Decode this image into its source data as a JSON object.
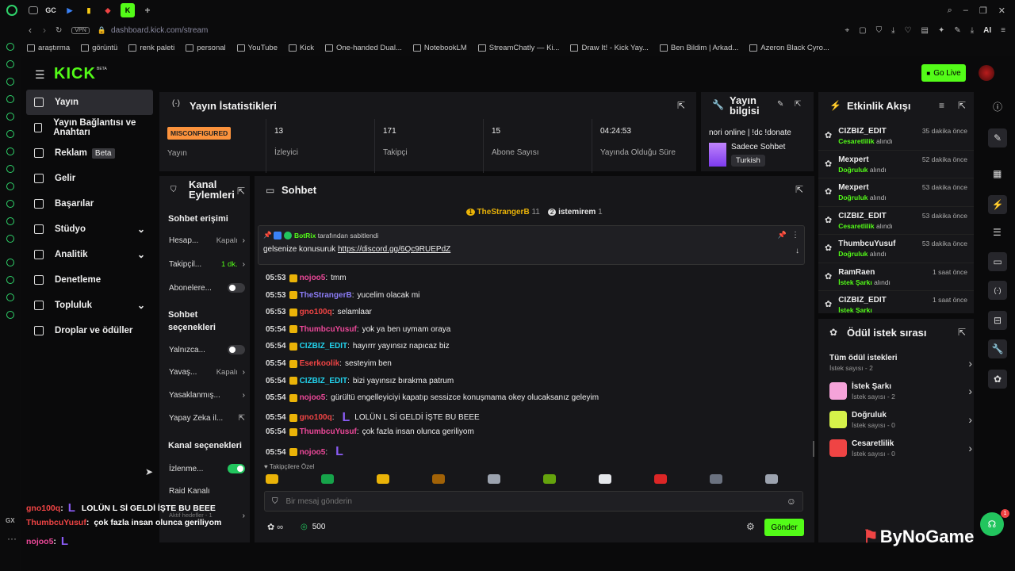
{
  "browser": {
    "url": "dashboard.kick.com/stream",
    "vpn": "VPN",
    "tab_text": "GC",
    "bookmarks": [
      "araştırma",
      "görüntü",
      "renk paleti",
      "personal",
      "YouTube",
      "Kick",
      "One-handed Dual...",
      "NotebookLM",
      "StreamChatly — Ki...",
      "Draw It! - Kick Yay...",
      "Ben Bildim | Arkad...",
      "Azeron Black Cyro..."
    ],
    "ai_label": "AI",
    "rail_bottom": "GX"
  },
  "header": {
    "logo": "KICK",
    "logo_beta": "BETA",
    "go_live": "Go Live"
  },
  "sidebar": {
    "items": [
      {
        "label": "Yayın",
        "active": true
      },
      {
        "label": "Yayın Bağlantısı ve Anahtarı"
      },
      {
        "label": "Reklam",
        "badge": "Beta"
      },
      {
        "label": "Gelir"
      },
      {
        "label": "Başarılar"
      },
      {
        "label": "Stüdyo",
        "chev": "⌄"
      },
      {
        "label": "Analitik",
        "chev": "⌄"
      },
      {
        "label": "Denetleme"
      },
      {
        "label": "Topluluk",
        "chev": "⌄"
      },
      {
        "label": "Droplar ve ödüller"
      }
    ]
  },
  "stats": {
    "title": "Yayın İstatistikleri",
    "status_badge": "MISCONFIGURED",
    "status_label": "Yayın",
    "items": [
      {
        "value": "13",
        "label": "İzleyici"
      },
      {
        "value": "171",
        "label": "Takipçi"
      },
      {
        "value": "15",
        "label": "Abone Sayısı"
      },
      {
        "value": "04:24:53",
        "label": "Yayında Olduğu Süre"
      }
    ]
  },
  "info": {
    "title": "Yayın bilgisi",
    "stream_title": "nori online | !dc !donate",
    "category": "Sadece Sohbet",
    "language": "Turkish"
  },
  "events": {
    "title": "Etkinlik Akışı",
    "items": [
      {
        "name": "CIZBIZ_EDIT",
        "reward": "Cesaretlilik",
        "suffix": "alındı",
        "time": "35 dakika önce"
      },
      {
        "name": "Mexpert",
        "reward": "Doğruluk",
        "suffix": "alındı",
        "time": "52 dakika önce"
      },
      {
        "name": "Mexpert",
        "reward": "Doğruluk",
        "suffix": "alındı",
        "time": "53 dakika önce"
      },
      {
        "name": "CIZBIZ_EDIT",
        "reward": "Cesaretlilik",
        "suffix": "alındı",
        "time": "53 dakika önce"
      },
      {
        "name": "ThumbcuYusuf",
        "reward": "Doğruluk",
        "suffix": "alındı",
        "time": "53 dakika önce"
      },
      {
        "name": "RamRaen",
        "reward": "İstek Şarkı",
        "suffix": "alındı",
        "time": "1 saat önce"
      },
      {
        "name": "CIZBIZ_EDIT",
        "reward": "İstek Şarkı",
        "suffix": "",
        "time": "1 saat önce"
      }
    ]
  },
  "rewards": {
    "title": "Ödül istek sırası",
    "all_label": "Tüm ödül istekleri",
    "all_count": "İstek sayısı - 2",
    "items": [
      {
        "name": "İstek Şarkı",
        "count": "İstek sayısı - 2",
        "color": "#f5a3d9"
      },
      {
        "name": "Doğruluk",
        "count": "İstek sayısı - 0",
        "color": "#d6f24a"
      },
      {
        "name": "Cesaretlilik",
        "count": "İstek sayısı - 0",
        "color": "#ef4444"
      }
    ]
  },
  "actions": {
    "title_1": "Kanal",
    "title_2": "Eylemleri",
    "sec_chat": "Sohbet erişimi",
    "rows": [
      {
        "label": "Hesap...",
        "val": "Kapalı"
      },
      {
        "label": "Takipçil...",
        "val": "1 dk."
      },
      {
        "label": "Abonelere..."
      }
    ],
    "sec_opts_1": "Sohbet",
    "sec_opts_2": "seçenekleri",
    "rows2": [
      {
        "label": "Yalnızca..."
      },
      {
        "label": "Yavaş...",
        "val": "Kapalı"
      },
      {
        "label": "Yasaklanmış..."
      },
      {
        "label": "Yapay Zeka il..."
      }
    ],
    "sec_channel": "Kanal seçenekleri",
    "rows3": [
      {
        "label": "İzlenme..."
      },
      {
        "label": "Raid Kanalı"
      }
    ],
    "footer": "Aktif hedefler - 1"
  },
  "chat": {
    "title": "Sohbet",
    "top_users": [
      {
        "rank": "1",
        "name": "TheStrangerB",
        "count": "11"
      },
      {
        "rank": "2",
        "name": "istemirem",
        "count": "1"
      }
    ],
    "pinned": {
      "by": "BotRix",
      "by_suffix": "tarafından sabitlendi",
      "text": "gelsenize konusuruk",
      "link": "https://discord.gg/6Qc9RUEPdZ"
    },
    "messages": [
      {
        "time": "05:53",
        "user": "nojoo5",
        "color": "#ec4899",
        "text": "tmm"
      },
      {
        "time": "05:53",
        "user": "TheStrangerB",
        "color": "#8b7cf6",
        "text": "yucelim olacak mi"
      },
      {
        "time": "05:53",
        "user": "gno100q",
        "color": "#ef4444",
        "text": "selamlaar"
      },
      {
        "time": "05:54",
        "user": "ThumbcuYusuf",
        "color": "#ec4899",
        "text": "yok ya ben uymam oraya"
      },
      {
        "time": "05:54",
        "user": "CIZBIZ_EDIT",
        "color": "#22d3ee",
        "text": "hayırrr yayınsız napıcaz biz"
      },
      {
        "time": "05:54",
        "user": "Eserkoolik",
        "color": "#ef4444",
        "text": "sesteyim ben"
      },
      {
        "time": "05:54",
        "user": "CIZBIZ_EDIT",
        "color": "#22d3ee",
        "text": "bizi yayınsız bırakma patrum"
      },
      {
        "time": "05:54",
        "user": "nojoo5",
        "color": "#ec4899",
        "text": "gürültü engelleyiciyi kapatıp sessizce konuşmama okey olucaksanız geleyim"
      },
      {
        "time": "05:54",
        "user": "gno100q",
        "color": "#ef4444",
        "text": "LOLÜN L Sİ GELDİ İŞTE BU BEEE"
      },
      {
        "time": "05:54",
        "user": "ThumbcuYusuf",
        "color": "#ec4899",
        "text": "çok fazla insan olunca geriliyom"
      },
      {
        "time": "05:54",
        "user": "nojoo5",
        "color": "#ec4899",
        "text": ""
      }
    ],
    "followers_only": "Takipçilere Özel",
    "placeholder": "Bir mesaj gönderin",
    "points": "500",
    "send": "Gönder"
  },
  "overlay": {
    "lines": [
      {
        "user": "gno100q",
        "color": "#ef4444",
        "text": "LOLÜN L Sİ GELDİ İŞTE BU BEEE"
      },
      {
        "user": "ThumbcuYusuf",
        "color": "#ef4444",
        "text": "çok fazla insan olunca geriliyom"
      },
      {
        "user": "nojoo5",
        "color": "#ec4899",
        "text": ""
      }
    ]
  },
  "watermark": "ByNoGame",
  "support_badge": "1",
  "colors": {
    "accent": "#53fc18",
    "panel": "#17171a",
    "bg": "#0c0c0d"
  }
}
